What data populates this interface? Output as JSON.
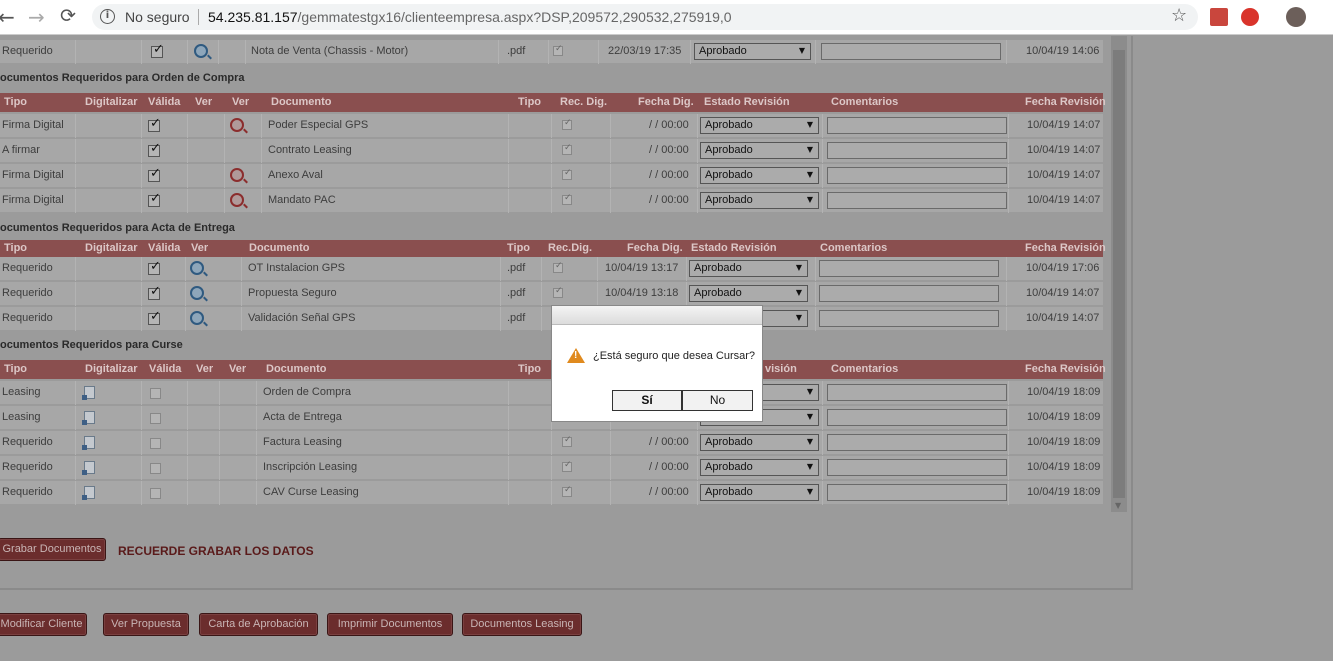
{
  "browser": {
    "back": "←",
    "forward": "→",
    "reload": "⟳",
    "info_icon": "i",
    "security_label": "No seguro",
    "url_host": "54.235.81.157",
    "url_path": "/gemmatestgx16/clienteempresa.aspx?DSP,209572,290532,275919,0",
    "star": "☆"
  },
  "top_row": {
    "tipo": "Requerido",
    "documento": "Nota de Venta (Chassis - Motor)",
    "ext": ".pdf",
    "fecha_dig": "22/03/19 17:35",
    "estado": "Aprobado",
    "fecha_rev": "10/04/19 14:06"
  },
  "section_oc": {
    "title": "ocumentos Requeridos para Orden de Compra",
    "headers": [
      "Tipo",
      "Digitalizar",
      "Válida",
      "Ver",
      "Ver",
      "Documento",
      "Tipo",
      "Rec. Dig.",
      "Fecha Dig.",
      "Estado Revisión",
      "Comentarios",
      "Fecha Revisión"
    ],
    "rows": [
      {
        "tipo": "Firma Digital",
        "documento": "Poder Especial GPS",
        "fecha_dig": "/ / 00:00",
        "estado": "Aprobado",
        "fecha_rev": "10/04/19 14:07"
      },
      {
        "tipo": "A firmar",
        "documento": "Contrato Leasing",
        "fecha_dig": "/ / 00:00",
        "estado": "Aprobado",
        "fecha_rev": "10/04/19 14:07"
      },
      {
        "tipo": "Firma Digital",
        "documento": "Anexo Aval",
        "fecha_dig": "/ / 00:00",
        "estado": "Aprobado",
        "fecha_rev": "10/04/19 14:07"
      },
      {
        "tipo": "Firma Digital",
        "documento": "Mandato PAC",
        "fecha_dig": "/ / 00:00",
        "estado": "Aprobado",
        "fecha_rev": "10/04/19 14:07"
      }
    ]
  },
  "section_ae": {
    "title": "ocumentos Requeridos para Acta de Entrega",
    "headers": [
      "Tipo",
      "Digitalizar",
      "Válida",
      "Ver",
      "Documento",
      "Tipo",
      "Rec.Dig.",
      "Fecha Dig.",
      "Estado Revisión",
      "Comentarios",
      "Fecha Revisión"
    ],
    "rows": [
      {
        "tipo": "Requerido",
        "documento": "OT Instalacion GPS",
        "ext": ".pdf",
        "fecha_dig": "10/04/19 13:17",
        "estado": "Aprobado",
        "fecha_rev": "10/04/19 17:06"
      },
      {
        "tipo": "Requerido",
        "documento": "Propuesta Seguro",
        "ext": ".pdf",
        "fecha_dig": "10/04/19 13:18",
        "estado": "Aprobado",
        "fecha_rev": "10/04/19 14:07"
      },
      {
        "tipo": "Requerido",
        "documento": "Validación Señal GPS",
        "ext": ".pdf",
        "fecha_dig": "",
        "estado": "",
        "fecha_rev": "10/04/19 14:07"
      }
    ]
  },
  "section_curse": {
    "title": "ocumentos Requeridos para Curse",
    "headers": [
      "Tipo",
      "Digitalizar",
      "Válida",
      "Ver",
      "Ver",
      "Documento",
      "Tipo",
      "",
      "",
      "visión",
      "Comentarios",
      "Fecha Revisión"
    ],
    "rows": [
      {
        "tipo": "Leasing",
        "documento": "Orden de Compra",
        "fecha_dig": "",
        "estado": "",
        "fecha_rev": "10/04/19 18:09"
      },
      {
        "tipo": "Leasing",
        "documento": "Acta de Entrega",
        "fecha_dig": "",
        "estado": "",
        "fecha_rev": "10/04/19 18:09"
      },
      {
        "tipo": "Requerido",
        "documento": "Factura Leasing",
        "fecha_dig": "/ / 00:00",
        "estado": "Aprobado",
        "fecha_rev": "10/04/19 18:09"
      },
      {
        "tipo": "Requerido",
        "documento": "Inscripción Leasing",
        "fecha_dig": "/ / 00:00",
        "estado": "Aprobado",
        "fecha_rev": "10/04/19 18:09"
      },
      {
        "tipo": "Requerido",
        "documento": "CAV Curse Leasing",
        "fecha_dig": "/ / 00:00",
        "estado": "Aprobado",
        "fecha_rev": "10/04/19 18:09"
      }
    ]
  },
  "actions": {
    "grabar": "Grabar Documentos",
    "reminder": "RECUERDE GRABAR LOS DATOS",
    "modificar": "Modificar Cliente",
    "ver_propuesta": "Ver Propuesta",
    "carta": "Carta de Aprobación",
    "imprimir": "Imprimir Documentos",
    "doc_leasing": "Documentos Leasing"
  },
  "dialog": {
    "message": "¿Está seguro que desea Cursar?",
    "yes": "Sí",
    "no": "No"
  },
  "colors": {
    "header": "#8a4f4f",
    "button": "#6b2d2d",
    "overlay": "#9b9b9b",
    "warning": "#e08a1e"
  },
  "icons": {
    "magnifier_blue": "search-icon",
    "magnifier_red": "search-icon",
    "document": "document-icon",
    "warning": "warning-icon"
  }
}
